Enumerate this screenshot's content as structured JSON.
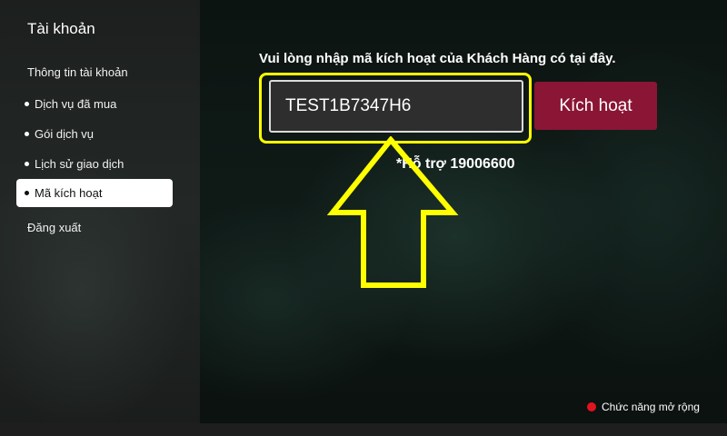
{
  "sidebar": {
    "title": "Tài khoản",
    "items": [
      {
        "label": "Thông tin tài khoản"
      },
      {
        "label": "Dịch vụ đã mua"
      },
      {
        "label": "Gói dịch vụ"
      },
      {
        "label": "Lịch sử giao dịch"
      },
      {
        "label": "Mã kích hoạt"
      },
      {
        "label": "Đăng xuất"
      }
    ]
  },
  "main": {
    "instruction": "Vui lòng nhập mã kích hoạt của Khách Hàng có tại đây.",
    "code_value": "TEST1B7347H6",
    "activate_label": "Kích hoạt",
    "support_text": "*Hỗ trợ 19006600"
  },
  "footer": {
    "hint_label": "Chức năng mở rộng"
  },
  "colors": {
    "accent": "#8a1535",
    "highlight": "#ffff00",
    "hint_dot": "#e0141f"
  },
  "icons": {
    "annotation": "up-arrow-icon",
    "hint": "red-dot-icon"
  }
}
